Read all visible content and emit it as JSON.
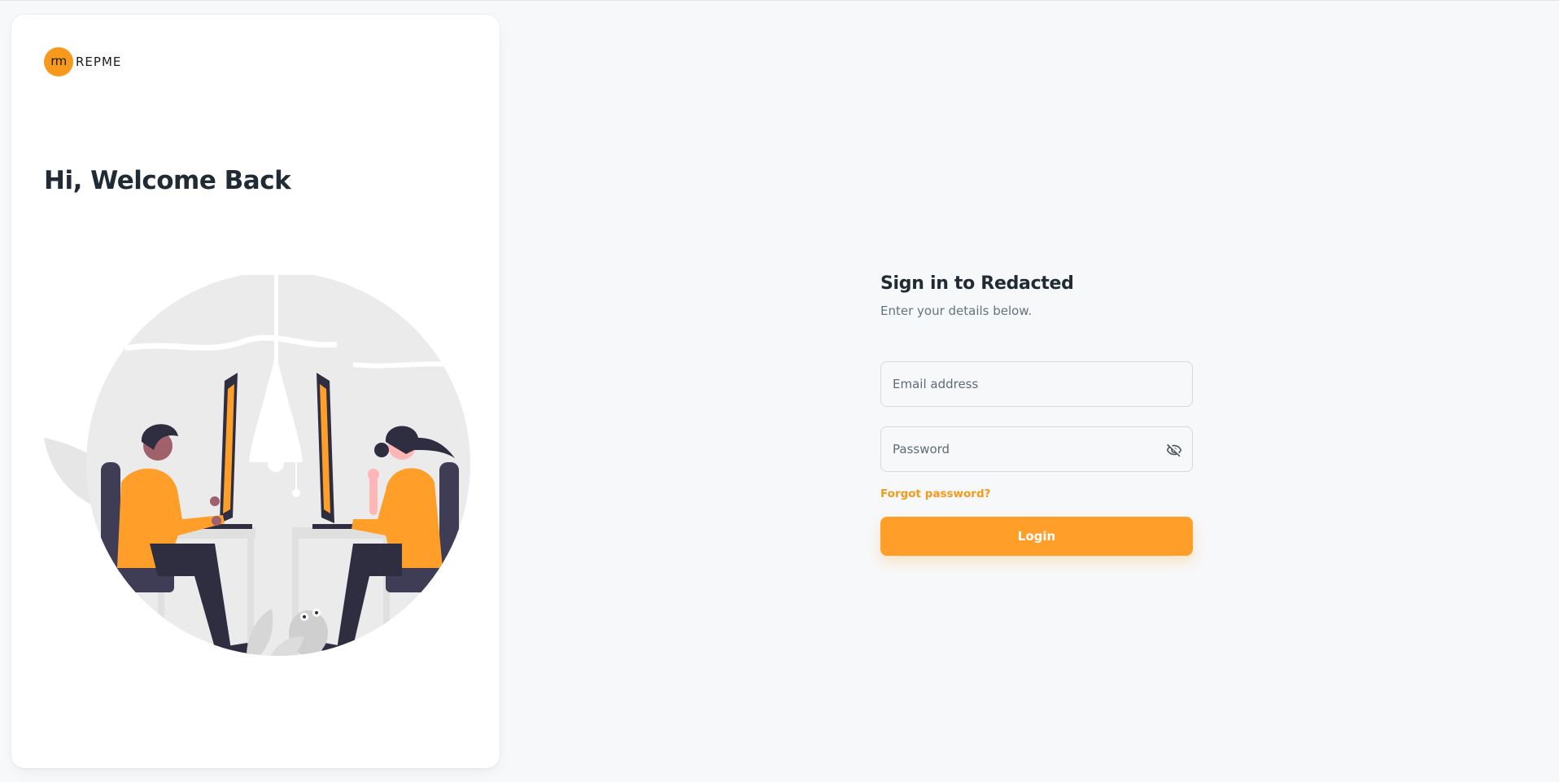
{
  "brand": {
    "badge_text": "rm",
    "name": "REPME",
    "accent_color": "#f7991c"
  },
  "left_panel": {
    "welcome_heading": "Hi, Welcome Back",
    "illustration": "two-people-working-at-computers"
  },
  "login_form": {
    "title": "Sign in to Redacted",
    "subtitle": "Enter your details below.",
    "email": {
      "placeholder": "Email address",
      "value": ""
    },
    "password": {
      "placeholder": "Password",
      "value": "",
      "toggle_icon": "eye-off-icon"
    },
    "forgot_link": "Forgot password?",
    "submit_label": "Login",
    "button_color": "#ff9f2a"
  }
}
